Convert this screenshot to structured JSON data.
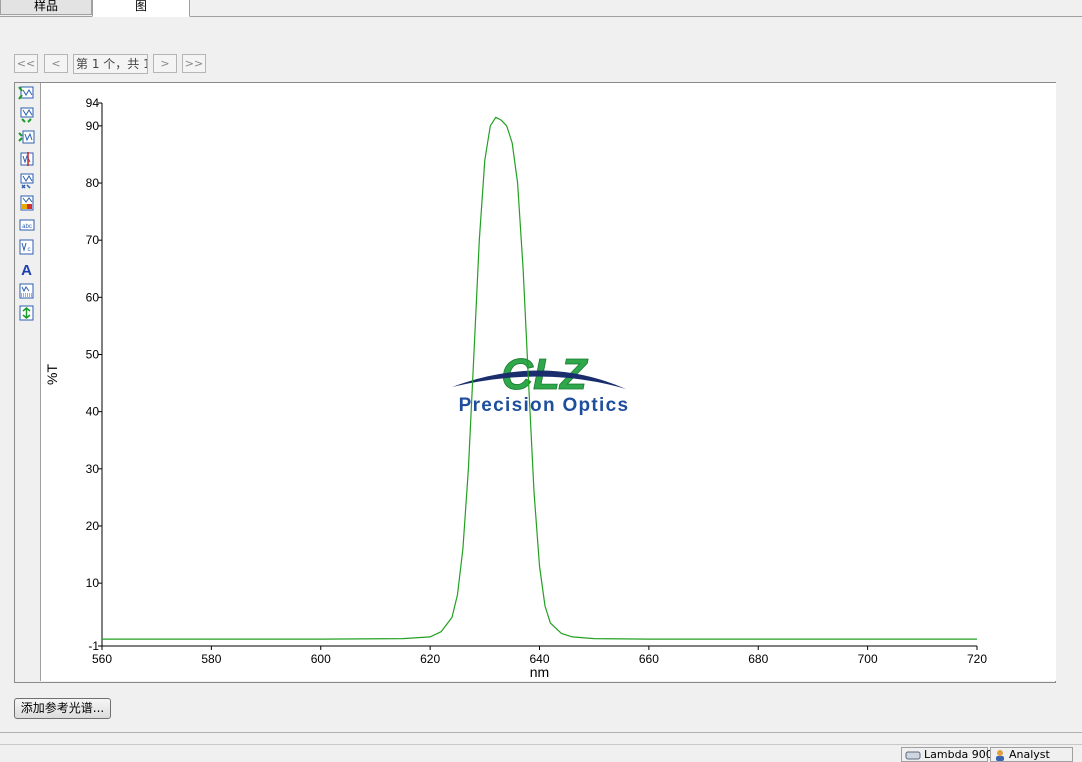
{
  "tabs": [
    {
      "label": "样品",
      "active": false
    },
    {
      "label": "图",
      "active": true
    }
  ],
  "navigator": {
    "first": "<<",
    "prev": "<",
    "label": "第 1 个，共 1",
    "next": ">",
    "last": ">>"
  },
  "toolbar_icons": [
    "auto-scale-icon",
    "zoom-in-icon",
    "zoom-out-icon",
    "cursor-icon",
    "peak-pick-icon",
    "color-legend-icon",
    "text-label-icon",
    "annotation-icon",
    "font-icon",
    "grid-icon",
    "export-icon"
  ],
  "logo": {
    "text_top": "CLZ",
    "text_bottom": "Precision Optics",
    "colors": {
      "green": "#2ea84a",
      "blue": "#1f4f9c",
      "navy": "#1a2e6e"
    }
  },
  "chart_data": {
    "type": "line",
    "xlabel": "nm",
    "ylabel": "%T",
    "xlim": [
      560,
      720
    ],
    "ylim": [
      -1,
      94
    ],
    "x_ticks": [
      560,
      580,
      600,
      620,
      640,
      660,
      680,
      700,
      720
    ],
    "y_ticks": [
      -1,
      10,
      20,
      30,
      40,
      50,
      60,
      70,
      80,
      90,
      94
    ],
    "grid": false,
    "series": [
      {
        "color": "#22a022",
        "x": [
          560,
          600,
          615,
          620,
          622,
          624,
          625,
          626,
          627,
          628,
          629,
          630,
          631,
          632,
          633,
          634,
          635,
          636,
          637,
          638,
          639,
          640,
          641,
          642,
          644,
          646,
          650,
          660,
          680,
          700,
          720
        ],
        "y": [
          0.2,
          0.2,
          0.3,
          0.6,
          1.5,
          4,
          8,
          16,
          30,
          50,
          70,
          84,
          90,
          91.5,
          91,
          90,
          87,
          80,
          65,
          45,
          26,
          13,
          6,
          3,
          1.2,
          0.6,
          0.3,
          0.2,
          0.2,
          0.2,
          0.2
        ]
      }
    ]
  },
  "add_button_label": "添加参考光谱...",
  "status_bar": {
    "instrument": "Lambda 900",
    "user": "Analyst"
  }
}
